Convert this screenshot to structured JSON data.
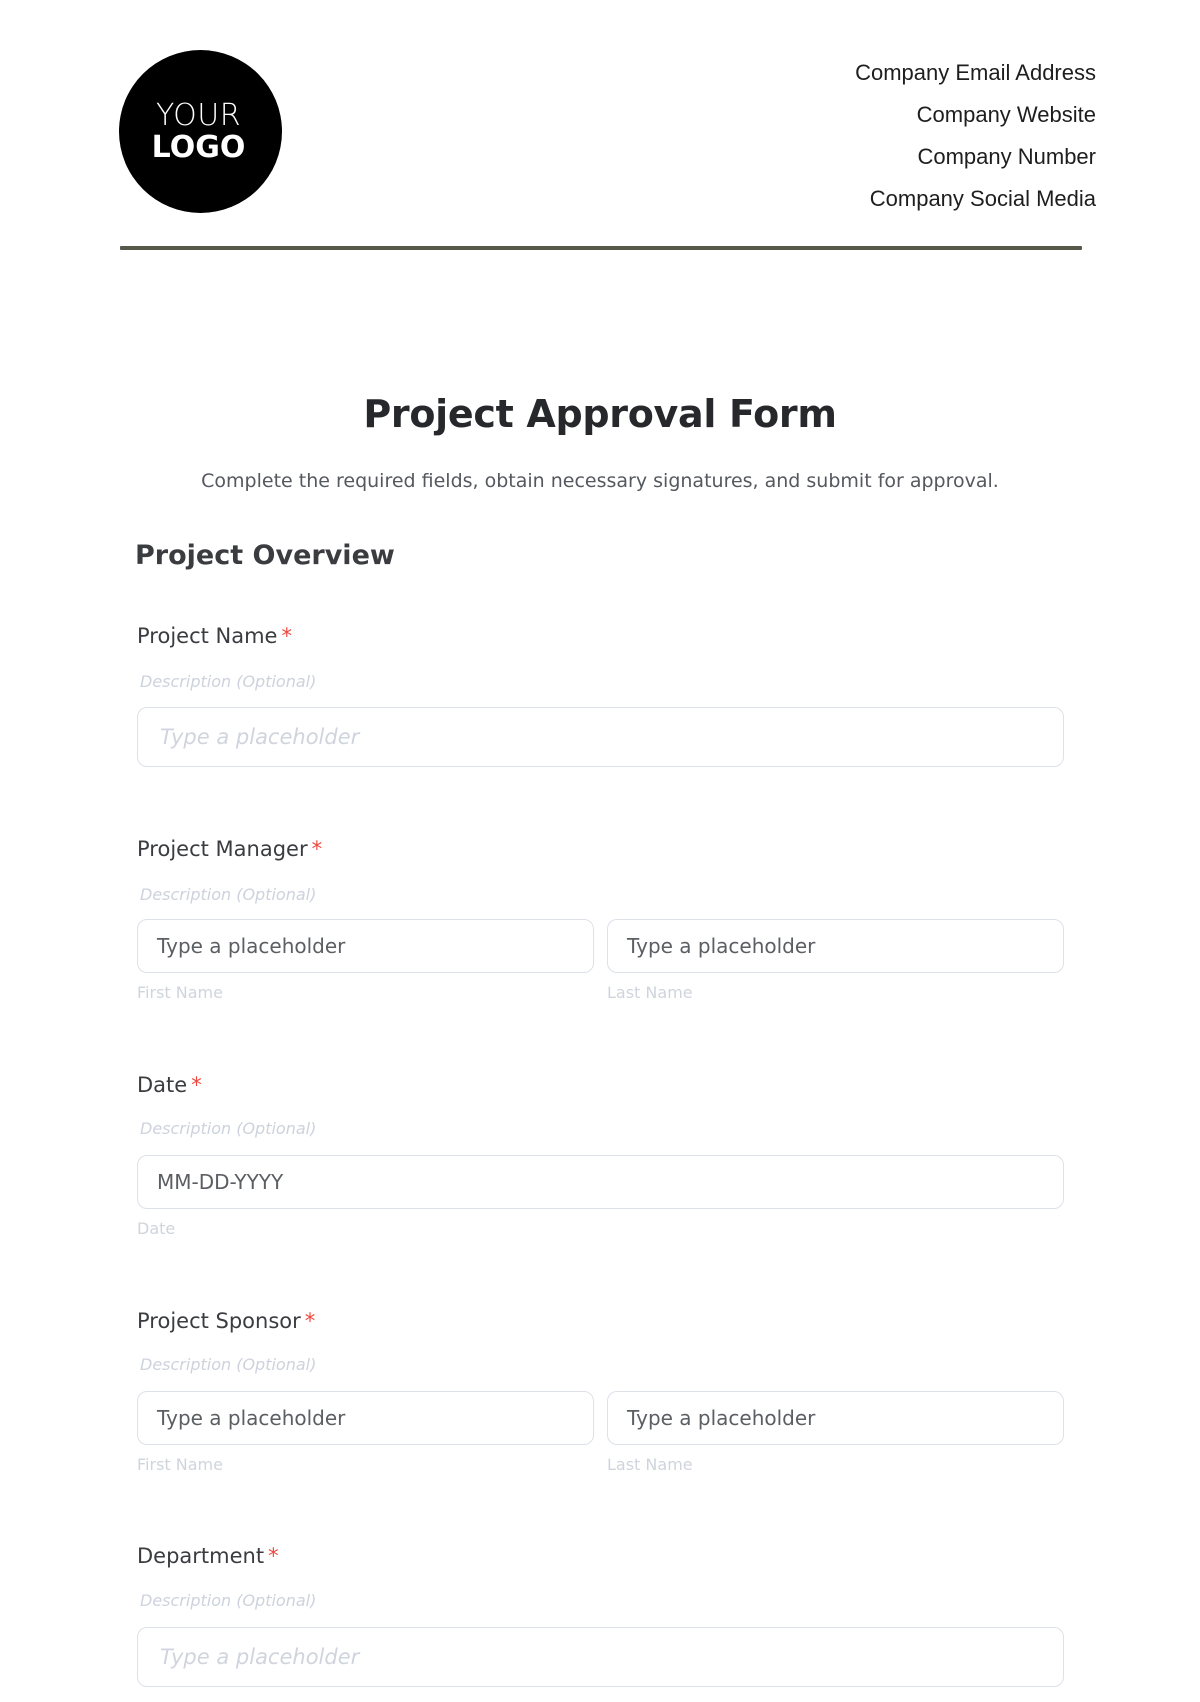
{
  "header": {
    "logo": {
      "line1": "YOUR",
      "line2": "LOGO"
    },
    "company_info": [
      "Company Email Address",
      "Company Website",
      "Company Number",
      "Company Social Media"
    ],
    "divider_color": "#565849"
  },
  "form": {
    "title": "Project Approval Form",
    "subtitle": "Complete the required fields, obtain necessary signatures, and submit for approval.",
    "section_heading": "Project Overview",
    "required_marker": "*",
    "required_color": "#f0483e",
    "fields": [
      {
        "label": "Project Name",
        "description": "Description (Optional)",
        "placeholder": "Type a placeholder"
      },
      {
        "label": "Project Manager",
        "description": "Description (Optional)",
        "first": {
          "value": "Type a placeholder",
          "sublabel": "First Name"
        },
        "last": {
          "value": "Type a placeholder",
          "sublabel": "Last Name"
        }
      },
      {
        "label": "Date",
        "description": "Description (Optional)",
        "value": "MM-DD-YYYY",
        "sublabel": "Date"
      },
      {
        "label": "Project Sponsor",
        "description": "Description (Optional)",
        "first": {
          "value": "Type a placeholder",
          "sublabel": "First Name"
        },
        "last": {
          "value": "Type a placeholder",
          "sublabel": "Last Name"
        }
      },
      {
        "label": "Department",
        "description": "Description (Optional)",
        "placeholder": "Type a placeholder"
      }
    ]
  }
}
